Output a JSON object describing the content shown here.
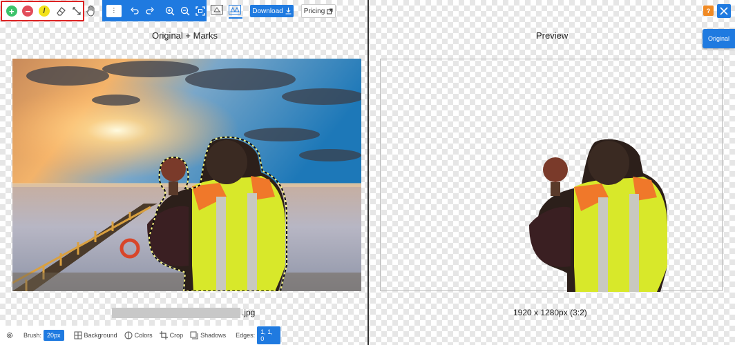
{
  "toolbar": {
    "select_value": "⋮",
    "download_label": "Download",
    "pricing_label": "Pricing"
  },
  "left_panel": {
    "title": "Original + Marks",
    "filename_ext": ".jpg"
  },
  "right_panel": {
    "title": "Preview",
    "dimensions": "1920 x 1280px (3:2)",
    "help_label": "?",
    "original_button": "Original"
  },
  "bottom_bar": {
    "brush_label": "Brush:",
    "brush_value": "20px",
    "background_label": "Background",
    "colors_label": "Colors",
    "crop_label": "Crop",
    "shadows_label": "Shadows",
    "edges_label": "Edges:",
    "edges_value": "1, 1, 0"
  },
  "icons": {
    "add": "plus-circle-icon",
    "remove": "minus-circle-icon",
    "brush": "brush-icon",
    "eraser": "eraser-icon",
    "magic": "magic-wand-icon",
    "hand": "hand-icon",
    "undo": "undo-icon",
    "redo": "redo-icon",
    "zoom_in": "zoom-in-icon",
    "zoom_out": "zoom-out-icon",
    "fit": "fit-screen-icon"
  },
  "colors": {
    "accent": "#1f7ae0",
    "add_green": "#3cc36a",
    "remove_red": "#e24c5a",
    "brush_yellow": "#f2e21a",
    "help_orange": "#f08a24"
  }
}
